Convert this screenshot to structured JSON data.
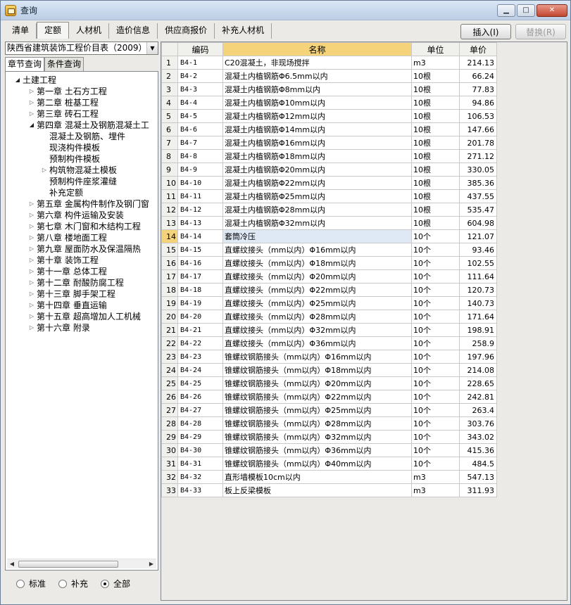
{
  "window": {
    "title": "查询"
  },
  "tabs": [
    "清单",
    "定额",
    "人材机",
    "造价信息",
    "供应商报价",
    "补充人材机"
  ],
  "active_tab": 1,
  "buttons": {
    "insert": "插入(I)",
    "replace": "替换(R)"
  },
  "left": {
    "selector": "陕西省建筑装饰工程价目表（2009）",
    "subtabs": [
      "章节查询",
      "条件查询"
    ],
    "tree": [
      {
        "label": "土建工程",
        "level": 0,
        "expander": "open"
      },
      {
        "label": "第一章  土石方工程",
        "level": 1,
        "expander": "closed"
      },
      {
        "label": "第二章  桩基工程",
        "level": 1,
        "expander": "closed"
      },
      {
        "label": "第三章  砖石工程",
        "level": 1,
        "expander": "closed"
      },
      {
        "label": "第四章  混凝土及钢筋混凝土工",
        "level": 1,
        "expander": "open"
      },
      {
        "label": "混凝土及钢筋、埋件",
        "level": 2,
        "expander": "none"
      },
      {
        "label": "现浇构件模板",
        "level": 2,
        "expander": "none"
      },
      {
        "label": "预制构件模板",
        "level": 2,
        "expander": "none"
      },
      {
        "label": "构筑物混凝土模板",
        "level": 2,
        "expander": "closed"
      },
      {
        "label": "预制构件座浆灌缝",
        "level": 2,
        "expander": "none"
      },
      {
        "label": "补充定额",
        "level": 2,
        "expander": "none"
      },
      {
        "label": "第五章  金属构件制作及钢门窗",
        "level": 1,
        "expander": "closed"
      },
      {
        "label": "第六章  构件运输及安装",
        "level": 1,
        "expander": "closed"
      },
      {
        "label": "第七章  木门窗和木结构工程",
        "level": 1,
        "expander": "closed"
      },
      {
        "label": "第八章  楼地面工程",
        "level": 1,
        "expander": "closed"
      },
      {
        "label": "第九章  屋面防水及保温隔热",
        "level": 1,
        "expander": "closed"
      },
      {
        "label": "第十章  装饰工程",
        "level": 1,
        "expander": "closed"
      },
      {
        "label": "第十一章  总体工程",
        "level": 1,
        "expander": "closed"
      },
      {
        "label": "第十二章  耐酸防腐工程",
        "level": 1,
        "expander": "closed"
      },
      {
        "label": "第十三章  脚手架工程",
        "level": 1,
        "expander": "closed"
      },
      {
        "label": "第十四章  垂直运输",
        "level": 1,
        "expander": "closed"
      },
      {
        "label": "第十五章  超高增加人工机械",
        "level": 1,
        "expander": "closed"
      },
      {
        "label": "第十六章  附录",
        "level": 1,
        "expander": "closed"
      }
    ],
    "radios": [
      "标准",
      "补充",
      "全部"
    ],
    "radio_selected": 2
  },
  "grid": {
    "columns": [
      "编码",
      "名称",
      "单位",
      "单价"
    ],
    "active_column": 1,
    "selected_row": 14,
    "rows": [
      [
        "B4-1",
        "C20混凝土，非现场搅拌",
        "m3",
        "214.13"
      ],
      [
        "B4-2",
        "混凝土内植钢筋Φ6.5mm以内",
        "10根",
        "66.24"
      ],
      [
        "B4-3",
        "混凝土内植钢筋Φ8mm以内",
        "10根",
        "77.83"
      ],
      [
        "B4-4",
        "混凝土内植钢筋Φ10mm以内",
        "10根",
        "94.86"
      ],
      [
        "B4-5",
        "混凝土内植钢筋Φ12mm以内",
        "10根",
        "106.53"
      ],
      [
        "B4-6",
        "混凝土内植钢筋Φ14mm以内",
        "10根",
        "147.66"
      ],
      [
        "B4-7",
        "混凝土内植钢筋Φ16mm以内",
        "10根",
        "201.78"
      ],
      [
        "B4-8",
        "混凝土内植钢筋Φ18mm以内",
        "10根",
        "271.12"
      ],
      [
        "B4-9",
        "混凝土内植钢筋Φ20mm以内",
        "10根",
        "330.05"
      ],
      [
        "B4-10",
        "混凝土内植钢筋Φ22mm以内",
        "10根",
        "385.36"
      ],
      [
        "B4-11",
        "混凝土内植钢筋Φ25mm以内",
        "10根",
        "437.55"
      ],
      [
        "B4-12",
        "混凝土内植钢筋Φ28mm以内",
        "10根",
        "535.47"
      ],
      [
        "B4-13",
        "混凝土内植钢筋Φ32mm以内",
        "10根",
        "604.98"
      ],
      [
        "B4-14",
        "套筒冷压",
        "10个",
        "121.07"
      ],
      [
        "B4-15",
        "直螺纹接头（mm以内）Φ16mm以内",
        "10个",
        "93.46"
      ],
      [
        "B4-16",
        "直螺纹接头（mm以内）Φ18mm以内",
        "10个",
        "102.55"
      ],
      [
        "B4-17",
        "直螺纹接头（mm以内）Φ20mm以内",
        "10个",
        "111.64"
      ],
      [
        "B4-18",
        "直螺纹接头（mm以内）Φ22mm以内",
        "10个",
        "120.73"
      ],
      [
        "B4-19",
        "直螺纹接头（mm以内）Φ25mm以内",
        "10个",
        "140.73"
      ],
      [
        "B4-20",
        "直螺纹接头（mm以内）Φ28mm以内",
        "10个",
        "171.64"
      ],
      [
        "B4-21",
        "直螺纹接头（mm以内）Φ32mm以内",
        "10个",
        "198.91"
      ],
      [
        "B4-22",
        "直螺纹接头（mm以内）Φ36mm以内",
        "10个",
        "258.9"
      ],
      [
        "B4-23",
        "锥螺纹钢筋接头（mm以内）Φ16mm以内",
        "10个",
        "197.96"
      ],
      [
        "B4-24",
        "锥螺纹钢筋接头（mm以内）Φ18mm以内",
        "10个",
        "214.08"
      ],
      [
        "B4-25",
        "锥螺纹钢筋接头（mm以内）Φ20mm以内",
        "10个",
        "228.65"
      ],
      [
        "B4-26",
        "锥螺纹钢筋接头（mm以内）Φ22mm以内",
        "10个",
        "242.81"
      ],
      [
        "B4-27",
        "锥螺纹钢筋接头（mm以内）Φ25mm以内",
        "10个",
        "263.4"
      ],
      [
        "B4-28",
        "锥螺纹钢筋接头（mm以内）Φ28mm以内",
        "10个",
        "303.76"
      ],
      [
        "B4-29",
        "锥螺纹钢筋接头（mm以内）Φ32mm以内",
        "10个",
        "343.02"
      ],
      [
        "B4-30",
        "锥螺纹钢筋接头（mm以内）Φ36mm以内",
        "10个",
        "415.36"
      ],
      [
        "B4-31",
        "锥螺纹钢筋接头（mm以内）Φ40mm以内",
        "10个",
        "484.5"
      ],
      [
        "B4-32",
        "直形墙模板10cm以内",
        "m3",
        "547.13"
      ],
      [
        "B4-33",
        "板上反梁模板",
        "m3",
        "311.93"
      ]
    ]
  }
}
